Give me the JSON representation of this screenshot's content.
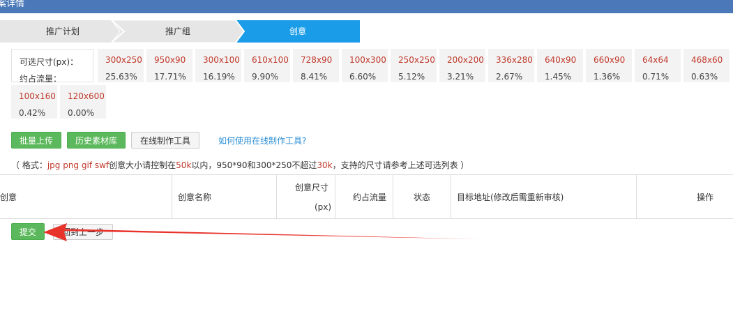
{
  "header": {
    "title": "案详情"
  },
  "steps": [
    {
      "label": "推广计划"
    },
    {
      "label": "推广组"
    },
    {
      "label": "创意"
    }
  ],
  "sizes": {
    "size_label": "可选尺寸(px)：",
    "traffic_label": "约占流量：",
    "items": [
      {
        "size": "300x250",
        "pct": "25.63%"
      },
      {
        "size": "950x90",
        "pct": "17.71%"
      },
      {
        "size": "300x100",
        "pct": "16.19%"
      },
      {
        "size": "610x100",
        "pct": "9.90%"
      },
      {
        "size": "728x90",
        "pct": "8.41%"
      },
      {
        "size": "100x300",
        "pct": "6.60%"
      },
      {
        "size": "250x250",
        "pct": "5.12%"
      },
      {
        "size": "200x200",
        "pct": "3.21%"
      },
      {
        "size": "336x280",
        "pct": "2.67%"
      },
      {
        "size": "640x90",
        "pct": "1.45%"
      },
      {
        "size": "660x90",
        "pct": "1.36%"
      },
      {
        "size": "64x64",
        "pct": "0.71%"
      },
      {
        "size": "468x60",
        "pct": "0.63%"
      },
      {
        "size": "100x160",
        "pct": "0.42%"
      },
      {
        "size": "120x600",
        "pct": "0.00%"
      }
    ]
  },
  "toolbar": {
    "batch_upload": "批量上传",
    "history_library": "历史素材库",
    "online_tool": "在线制作工具",
    "help_link": "如何使用在线制作工具?"
  },
  "note": {
    "p1": "（ 格式：",
    "formats": "jpg png gif swf",
    "p2": "创意大小请控制在",
    "limit1": "50k",
    "p3": "以内，950*90和300*250不超过",
    "limit2": "30k",
    "p4": "，支持的尺寸请参考上述可选列表 ）"
  },
  "table": {
    "col_creative": "创意",
    "col_name": "创意名称",
    "col_size_line1": "创意尺寸",
    "col_size_line2": "(px)",
    "col_traffic": "约占流量",
    "col_status": "状态",
    "col_target": "目标地址(修改后需重新审核)",
    "col_action": "操作"
  },
  "actions": {
    "submit": "提交",
    "back": "回到上一步"
  },
  "colors": {
    "header_bg": "#4a78b8",
    "active_step": "#1a9ce8",
    "green": "#5cb85c",
    "arrow": "#e8332b"
  }
}
